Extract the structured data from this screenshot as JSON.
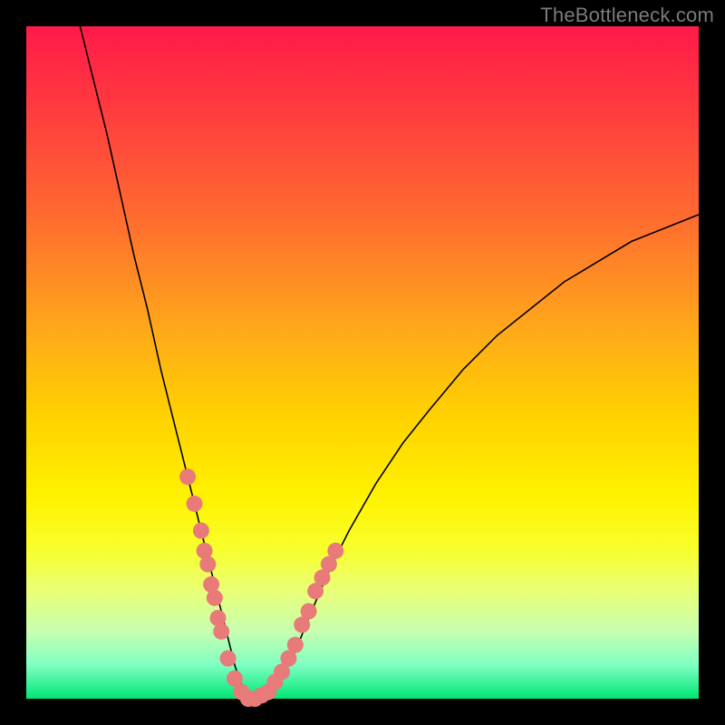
{
  "watermark": "TheBottleneck.com",
  "colors": {
    "background": "#000000",
    "curve": "#000000",
    "markers": "#e97a7a",
    "gradient_top": "#ff1a49",
    "gradient_bottom": "#00e676"
  },
  "chart_data": {
    "type": "line",
    "title": "",
    "xlabel": "",
    "ylabel": "",
    "xlim": [
      0,
      100
    ],
    "ylim": [
      0,
      100
    ],
    "note": "No numeric axis ticks are shown; values are normalized 0–100 estimates from the rendered curve.",
    "series": [
      {
        "name": "bottleneck-curve",
        "x": [
          8,
          10,
          12,
          14,
          16,
          18,
          20,
          22,
          24,
          26,
          28,
          30,
          31,
          32,
          33,
          34,
          35,
          36,
          38,
          40,
          42,
          45,
          48,
          52,
          56,
          60,
          65,
          70,
          75,
          80,
          85,
          90,
          95,
          100
        ],
        "values": [
          100,
          92,
          84,
          75,
          66,
          58,
          49,
          41,
          33,
          25,
          17,
          9,
          5,
          2,
          0,
          0,
          0,
          1,
          3,
          7,
          12,
          19,
          25,
          32,
          38,
          43,
          49,
          54,
          58,
          62,
          65,
          68,
          70,
          72
        ]
      }
    ],
    "markers": {
      "name": "highlighted-points",
      "note": "Pink dot cluster near the valley region (approximate).",
      "points": [
        {
          "x": 24,
          "y": 33
        },
        {
          "x": 25,
          "y": 29
        },
        {
          "x": 26,
          "y": 25
        },
        {
          "x": 26.5,
          "y": 22
        },
        {
          "x": 27,
          "y": 20
        },
        {
          "x": 27.5,
          "y": 17
        },
        {
          "x": 28,
          "y": 15
        },
        {
          "x": 28.5,
          "y": 12
        },
        {
          "x": 29,
          "y": 10
        },
        {
          "x": 30,
          "y": 6
        },
        {
          "x": 31,
          "y": 3
        },
        {
          "x": 32,
          "y": 1
        },
        {
          "x": 33,
          "y": 0
        },
        {
          "x": 34,
          "y": 0
        },
        {
          "x": 35,
          "y": 0.5
        },
        {
          "x": 36,
          "y": 1
        },
        {
          "x": 37,
          "y": 2.5
        },
        {
          "x": 38,
          "y": 4
        },
        {
          "x": 39,
          "y": 6
        },
        {
          "x": 40,
          "y": 8
        },
        {
          "x": 41,
          "y": 11
        },
        {
          "x": 42,
          "y": 13
        },
        {
          "x": 43,
          "y": 16
        },
        {
          "x": 44,
          "y": 18
        },
        {
          "x": 45,
          "y": 20
        },
        {
          "x": 46,
          "y": 22
        }
      ]
    }
  }
}
